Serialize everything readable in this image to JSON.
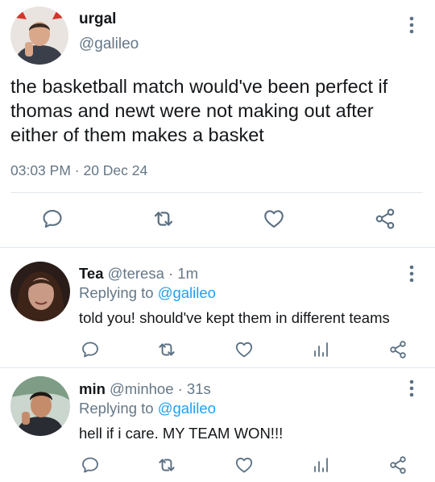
{
  "main_tweet": {
    "display_name": "urgal",
    "handle": "@galileo",
    "text": "the basketball match would've been perfect if thomas and newt were not making out after either of them makes a basket",
    "timestamp": "03:03 PM · 20 Dec 24",
    "actions": [
      "reply-icon",
      "retweet-icon",
      "like-icon",
      "share-icon"
    ]
  },
  "replies": [
    {
      "display_name": "Tea",
      "meta": "@teresa · 1m",
      "replying_prefix": "Replying to ",
      "replying_to": "@galileo",
      "text": "told you! should've kept them in different teams",
      "actions": [
        "reply-icon",
        "retweet-icon",
        "like-icon",
        "analytics-icon",
        "share-icon"
      ]
    },
    {
      "display_name": "min",
      "meta": "@minhoe · 31s",
      "replying_prefix": "Replying to ",
      "replying_to": "@galileo",
      "text": "hell if i care. MY TEAM WON!!!",
      "actions": [
        "reply-icon",
        "retweet-icon",
        "like-icon",
        "analytics-icon",
        "share-icon"
      ]
    }
  ],
  "colors": {
    "text": "#14171a",
    "secondary": "#657786",
    "mention": "#1da1f2",
    "divider": "#e1e8ed",
    "icon": "#5b7083"
  }
}
